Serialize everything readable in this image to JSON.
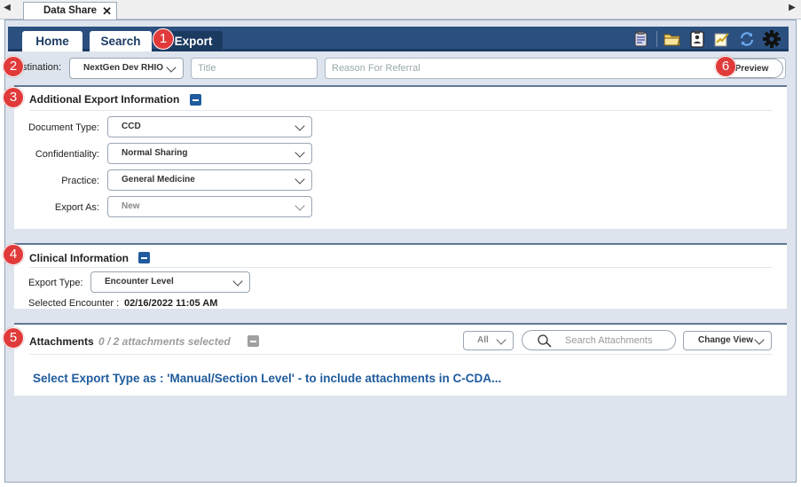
{
  "doc_tab": {
    "label": "Data Share",
    "close": "✕"
  },
  "nav_tabs": {
    "home": "Home",
    "search": "Search",
    "export": "Export"
  },
  "destination": {
    "label": "Destination:",
    "value": "NextGen Dev RHIO",
    "title_placeholder": "Title",
    "reason_placeholder": "Reason For Referral",
    "preview_label": "Preview"
  },
  "additional_export": {
    "title": "Additional Export Information",
    "fields": {
      "document_type": {
        "label": "Document Type:",
        "value": "CCD"
      },
      "confidentiality": {
        "label": "Confidentiality:",
        "value": "Normal Sharing"
      },
      "practice": {
        "label": "Practice:",
        "value": "General Medicine"
      },
      "export_as": {
        "label": "Export As:",
        "value": "New"
      }
    }
  },
  "clinical": {
    "title": "Clinical Information",
    "export_type_label": "Export Type:",
    "export_type_value": "Encounter Level",
    "selected_encounter_label": "Selected Encounter :",
    "selected_encounter_value": "02/16/2022 11:05 AM"
  },
  "attachments": {
    "title": "Attachments",
    "count_text": "0 / 2 attachments selected",
    "filter_value": "All",
    "search_placeholder": "Search Attachments",
    "change_view_label": "Change View",
    "message": "Select Export Type as : 'Manual/Section Level' - to include attachments in C-CDA..."
  },
  "callouts": [
    "1",
    "2",
    "3",
    "4",
    "5",
    "6"
  ],
  "toolbar_icons": [
    "clipboard-icon",
    "folder-icon",
    "patient-card-icon",
    "sign-icon",
    "refresh-icon",
    "gear-icon"
  ],
  "colors": {
    "header_blue": "#2b5080",
    "accent_blue": "#1f5b9d",
    "callout_red": "#e03a3a"
  }
}
